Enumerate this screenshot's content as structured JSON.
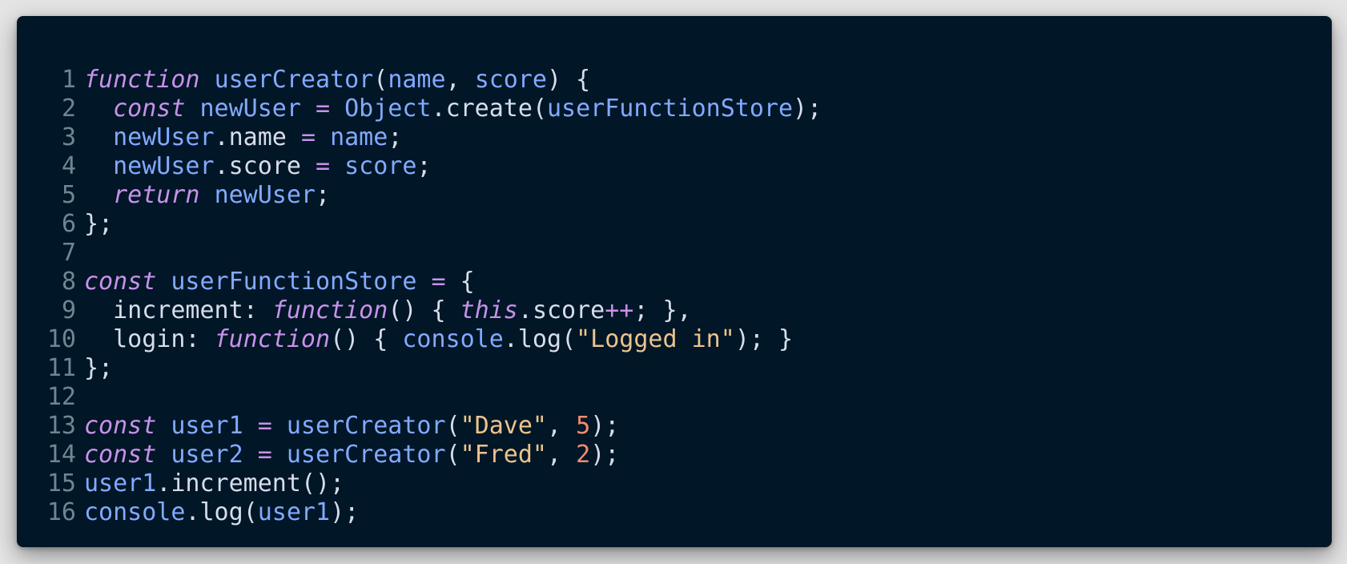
{
  "code": {
    "language": "javascript",
    "lines": [
      {
        "n": "1",
        "tokens": [
          {
            "t": "function",
            "c": "kw"
          },
          {
            "t": " ",
            "c": "punc"
          },
          {
            "t": "userCreator",
            "c": "fn"
          },
          {
            "t": "(",
            "c": "punc"
          },
          {
            "t": "name",
            "c": "var"
          },
          {
            "t": ", ",
            "c": "punc"
          },
          {
            "t": "score",
            "c": "var"
          },
          {
            "t": ") {",
            "c": "punc"
          }
        ]
      },
      {
        "n": "2",
        "tokens": [
          {
            "t": "  ",
            "c": "punc"
          },
          {
            "t": "const",
            "c": "kw"
          },
          {
            "t": " ",
            "c": "punc"
          },
          {
            "t": "newUser",
            "c": "var"
          },
          {
            "t": " ",
            "c": "punc"
          },
          {
            "t": "=",
            "c": "op"
          },
          {
            "t": " ",
            "c": "punc"
          },
          {
            "t": "Object",
            "c": "var"
          },
          {
            "t": ".",
            "c": "punc"
          },
          {
            "t": "create",
            "c": "prop"
          },
          {
            "t": "(",
            "c": "punc"
          },
          {
            "t": "userFunctionStore",
            "c": "var"
          },
          {
            "t": ");",
            "c": "punc"
          }
        ]
      },
      {
        "n": "3",
        "tokens": [
          {
            "t": "  ",
            "c": "punc"
          },
          {
            "t": "newUser",
            "c": "var"
          },
          {
            "t": ".",
            "c": "punc"
          },
          {
            "t": "name",
            "c": "prop"
          },
          {
            "t": " ",
            "c": "punc"
          },
          {
            "t": "=",
            "c": "op"
          },
          {
            "t": " ",
            "c": "punc"
          },
          {
            "t": "name",
            "c": "var"
          },
          {
            "t": ";",
            "c": "punc"
          }
        ]
      },
      {
        "n": "4",
        "tokens": [
          {
            "t": "  ",
            "c": "punc"
          },
          {
            "t": "newUser",
            "c": "var"
          },
          {
            "t": ".",
            "c": "punc"
          },
          {
            "t": "score",
            "c": "prop"
          },
          {
            "t": " ",
            "c": "punc"
          },
          {
            "t": "=",
            "c": "op"
          },
          {
            "t": " ",
            "c": "punc"
          },
          {
            "t": "score",
            "c": "var"
          },
          {
            "t": ";",
            "c": "punc"
          }
        ]
      },
      {
        "n": "5",
        "tokens": [
          {
            "t": "  ",
            "c": "punc"
          },
          {
            "t": "return",
            "c": "kw"
          },
          {
            "t": " ",
            "c": "punc"
          },
          {
            "t": "newUser",
            "c": "var"
          },
          {
            "t": ";",
            "c": "punc"
          }
        ]
      },
      {
        "n": "6",
        "tokens": [
          {
            "t": "};",
            "c": "punc"
          }
        ]
      },
      {
        "n": "7",
        "tokens": []
      },
      {
        "n": "8",
        "tokens": [
          {
            "t": "const",
            "c": "kw"
          },
          {
            "t": " ",
            "c": "punc"
          },
          {
            "t": "userFunctionStore",
            "c": "var"
          },
          {
            "t": " ",
            "c": "punc"
          },
          {
            "t": "=",
            "c": "op"
          },
          {
            "t": " {",
            "c": "punc"
          }
        ]
      },
      {
        "n": "9",
        "tokens": [
          {
            "t": "  ",
            "c": "punc"
          },
          {
            "t": "increment",
            "c": "prop"
          },
          {
            "t": ": ",
            "c": "punc"
          },
          {
            "t": "function",
            "c": "kw"
          },
          {
            "t": "() { ",
            "c": "punc"
          },
          {
            "t": "this",
            "c": "kw"
          },
          {
            "t": ".",
            "c": "punc"
          },
          {
            "t": "score",
            "c": "prop"
          },
          {
            "t": "++",
            "c": "op"
          },
          {
            "t": "; },",
            "c": "punc"
          }
        ]
      },
      {
        "n": "10",
        "tokens": [
          {
            "t": "  ",
            "c": "punc"
          },
          {
            "t": "login",
            "c": "prop"
          },
          {
            "t": ": ",
            "c": "punc"
          },
          {
            "t": "function",
            "c": "kw"
          },
          {
            "t": "() { ",
            "c": "punc"
          },
          {
            "t": "console",
            "c": "var"
          },
          {
            "t": ".",
            "c": "punc"
          },
          {
            "t": "log",
            "c": "prop"
          },
          {
            "t": "(",
            "c": "punc"
          },
          {
            "t": "\"Logged in\"",
            "c": "str"
          },
          {
            "t": "); }",
            "c": "punc"
          }
        ]
      },
      {
        "n": "11",
        "tokens": [
          {
            "t": "};",
            "c": "punc"
          }
        ]
      },
      {
        "n": "12",
        "tokens": []
      },
      {
        "n": "13",
        "tokens": [
          {
            "t": "const",
            "c": "kw"
          },
          {
            "t": " ",
            "c": "punc"
          },
          {
            "t": "user1",
            "c": "var"
          },
          {
            "t": " ",
            "c": "punc"
          },
          {
            "t": "=",
            "c": "op"
          },
          {
            "t": " ",
            "c": "punc"
          },
          {
            "t": "userCreator",
            "c": "fn"
          },
          {
            "t": "(",
            "c": "punc"
          },
          {
            "t": "\"Dave\"",
            "c": "str"
          },
          {
            "t": ", ",
            "c": "punc"
          },
          {
            "t": "5",
            "c": "num"
          },
          {
            "t": ");",
            "c": "punc"
          }
        ]
      },
      {
        "n": "14",
        "tokens": [
          {
            "t": "const",
            "c": "kw"
          },
          {
            "t": " ",
            "c": "punc"
          },
          {
            "t": "user2",
            "c": "var"
          },
          {
            "t": " ",
            "c": "punc"
          },
          {
            "t": "=",
            "c": "op"
          },
          {
            "t": " ",
            "c": "punc"
          },
          {
            "t": "userCreator",
            "c": "fn"
          },
          {
            "t": "(",
            "c": "punc"
          },
          {
            "t": "\"Fred\"",
            "c": "str"
          },
          {
            "t": ", ",
            "c": "punc"
          },
          {
            "t": "2",
            "c": "num"
          },
          {
            "t": ");",
            "c": "punc"
          }
        ]
      },
      {
        "n": "15",
        "tokens": [
          {
            "t": "user1",
            "c": "var"
          },
          {
            "t": ".",
            "c": "punc"
          },
          {
            "t": "increment",
            "c": "prop"
          },
          {
            "t": "();",
            "c": "punc"
          }
        ]
      },
      {
        "n": "16",
        "tokens": [
          {
            "t": "console",
            "c": "var"
          },
          {
            "t": ".",
            "c": "punc"
          },
          {
            "t": "log",
            "c": "prop"
          },
          {
            "t": "(",
            "c": "punc"
          },
          {
            "t": "user1",
            "c": "var"
          },
          {
            "t": ");",
            "c": "punc"
          }
        ]
      }
    ]
  },
  "theme": {
    "background": "#011627",
    "page_background": "#e4e4e4",
    "keyword": "#c792ea",
    "function": "#82aaff",
    "variable": "#82aaff",
    "property": "#d6deeb",
    "operator": "#c792ea",
    "punctuation": "#d6deeb",
    "string": "#ecc48d",
    "number": "#f78c6c",
    "line_number": "#6c8794"
  }
}
